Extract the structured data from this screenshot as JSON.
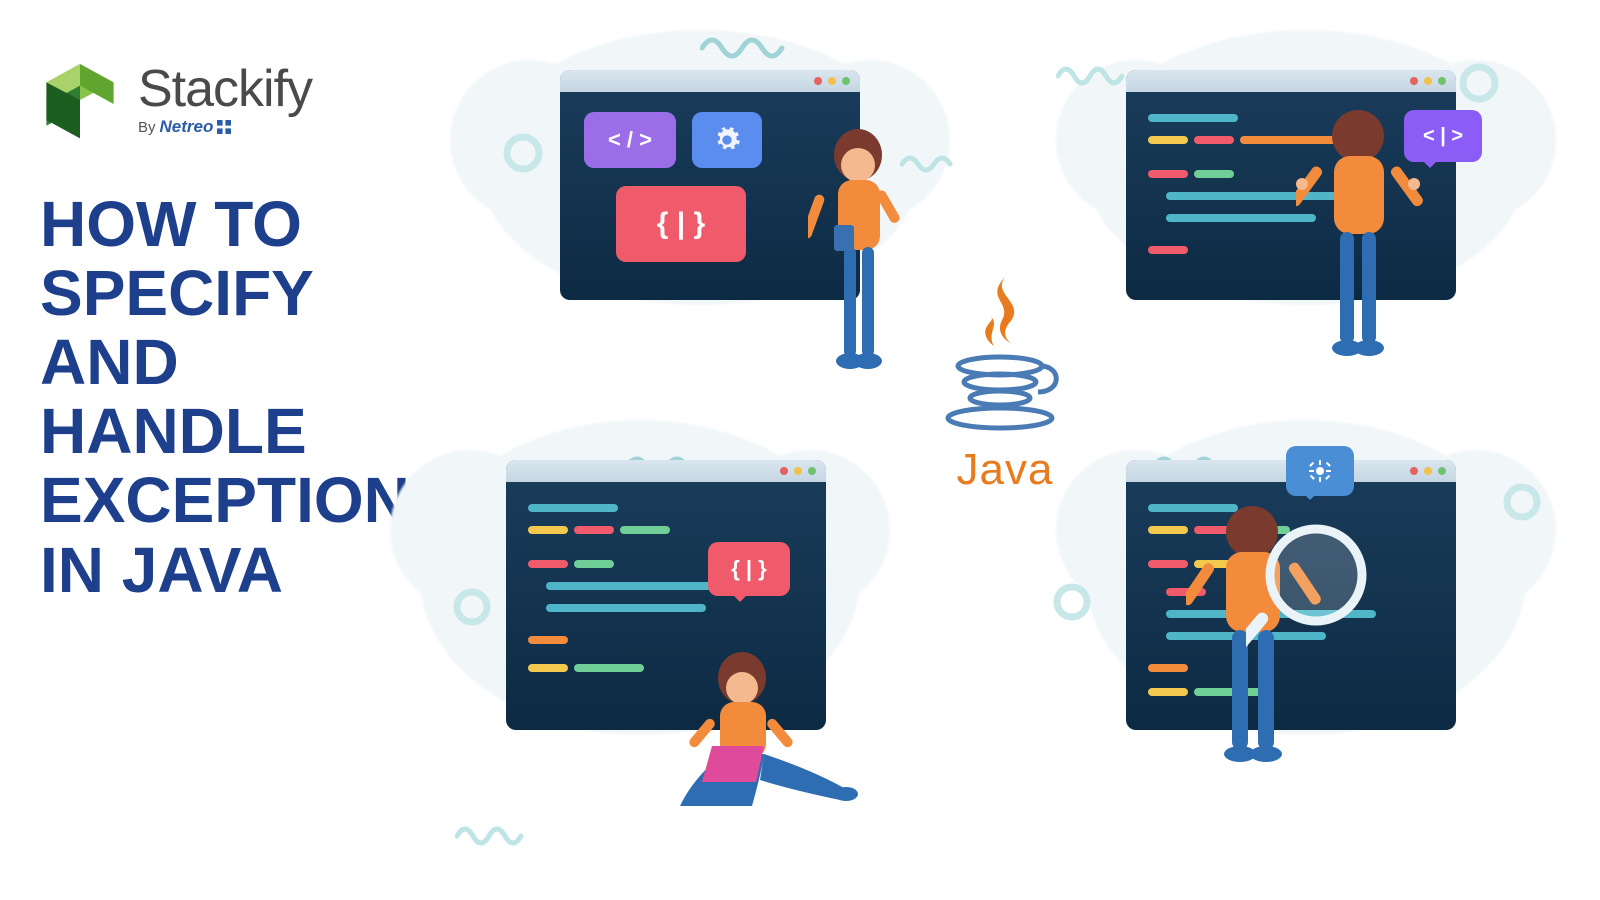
{
  "brand": {
    "name": "Stackify",
    "by": "By",
    "parent": "Netreo"
  },
  "title": "HOW TO SPECIFY AND HANDLE EXCEPTIONS IN JAVA",
  "java_label": "Java",
  "chips": {
    "code_tag": "< / >",
    "braces_left": "{ | }",
    "code_tag_alt": "< | >",
    "braces_right": "{ | }"
  }
}
